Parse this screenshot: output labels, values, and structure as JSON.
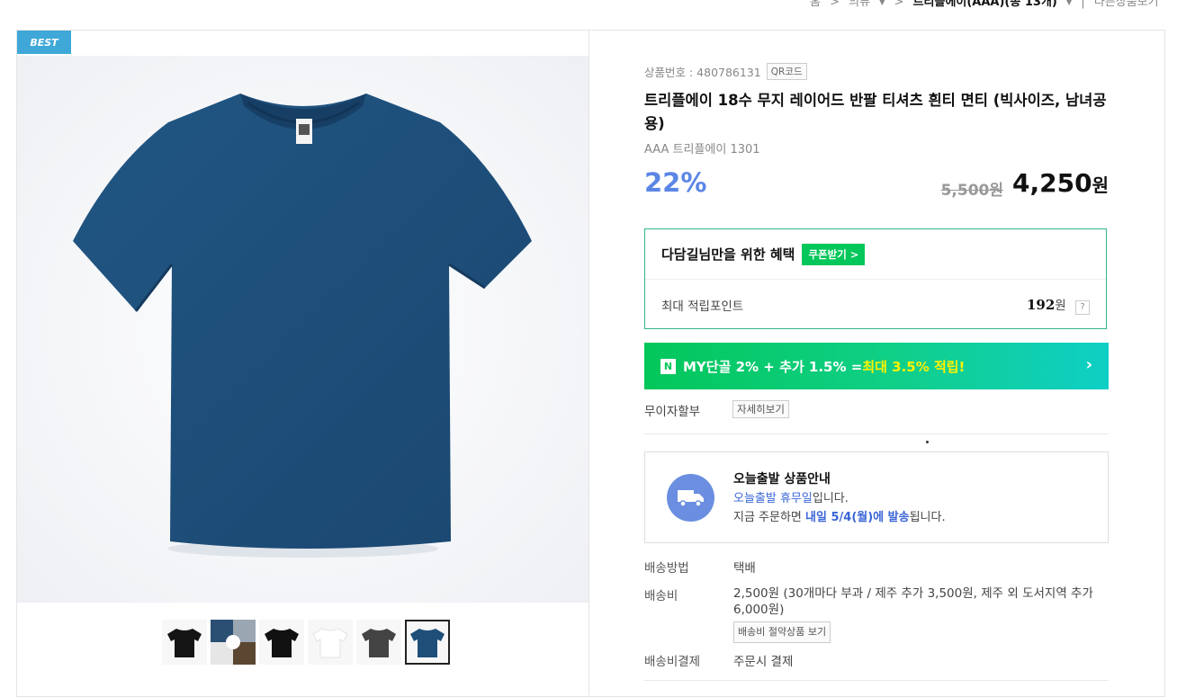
{
  "breadcrumb": {
    "home": "홈",
    "cat1": "의류",
    "brand": "트리플에이(AAA)(총 13개)",
    "other": "다른상품보기"
  },
  "badge": "BEST",
  "product": {
    "number_label": "상품번호 : 480786131",
    "qr": "QR코드",
    "title": "트리플에이 18수 무지 레이어드 반팔 티셔츠 흰티 면티 (빅사이즈, 남녀공용)",
    "subtitle": "AAA 트리플에이 1301",
    "discount": "22%",
    "original_price": "5,500원",
    "final_price": "4,250",
    "final_unit": "원"
  },
  "benefit": {
    "title": "다담길님만을 위한 혜택",
    "coupon_btn": "쿠폰받기 >",
    "point_label": "최대 적립포인트",
    "point_value": "192",
    "point_unit": "원",
    "help": "?"
  },
  "mybar": {
    "logo": "N",
    "text1": "MY단골 2% + 추가 1.5% = ",
    "text2": "최대 3.5% 적립!",
    "chevron": "›"
  },
  "installment": {
    "label": "무이자할부",
    "btn": "자세히보기"
  },
  "shipping_box": {
    "title": "오늘출발 상품안내",
    "line1_a": "오늘출발 휴무일",
    "line1_b": "입니다.",
    "line2_a": "지금 주문하면 ",
    "line2_b": "내일 5/4(월)에 발송",
    "line2_c": "됩니다."
  },
  "delivery": {
    "method_label": "배송방법",
    "method_value": "택배",
    "fee_label": "배송비",
    "fee_value": "2,500원 (30개마다 부과 / 제주 추가 3,500원, 제주 외 도서지역 추가 6,000원)",
    "fee_btn": "배송비 절약상품 보기",
    "pay_label": "배송비결제",
    "pay_value": "주문시 결제"
  },
  "colors": {
    "accent_blue": "#5b86e5",
    "naver_green": "#03c75a",
    "badge_blue": "#3fa8d8",
    "shirt_navy": "#1e4f79"
  },
  "thumbnails": [
    {
      "name": "black",
      "color": "#151515"
    },
    {
      "name": "collage",
      "color": "#5a6b7a"
    },
    {
      "name": "black-2",
      "color": "#111111"
    },
    {
      "name": "white",
      "color": "#f4f4f4"
    },
    {
      "name": "charcoal",
      "color": "#444444"
    },
    {
      "name": "navy",
      "color": "#1e4f79"
    }
  ]
}
